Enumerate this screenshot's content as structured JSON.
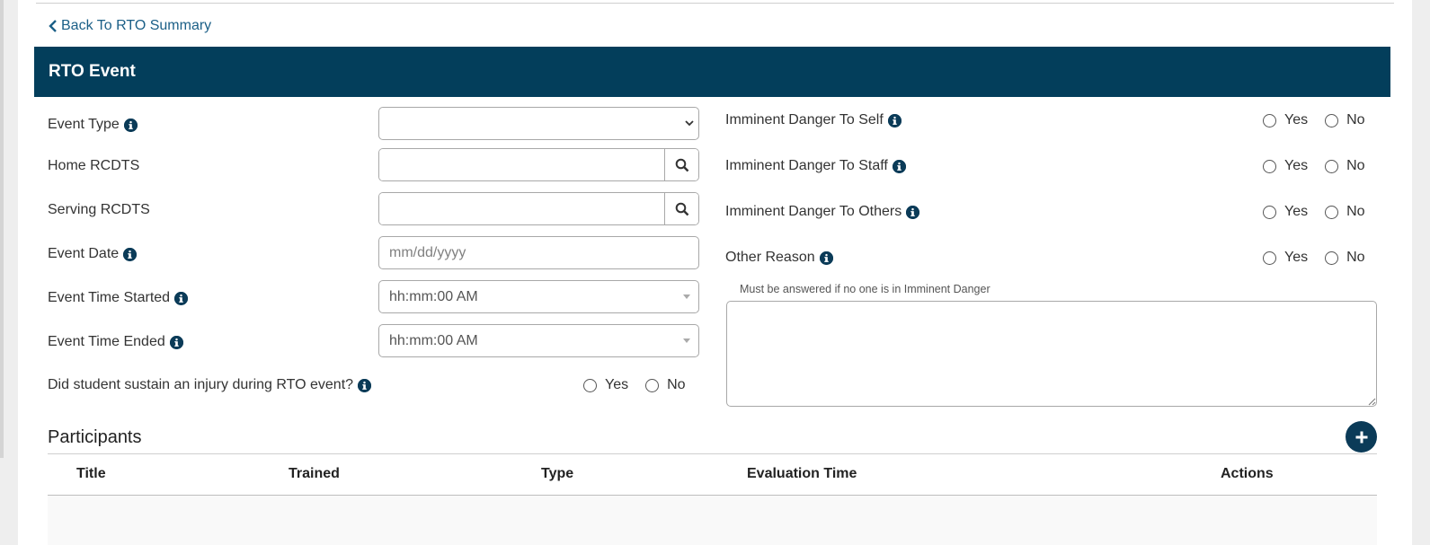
{
  "back_link": {
    "label": "Back To RTO Summary"
  },
  "header": {
    "title": "RTO Event"
  },
  "form": {
    "event_type": {
      "label": "Event Type",
      "value": ""
    },
    "home_rcdts": {
      "label": "Home RCDTS",
      "value": ""
    },
    "serving_rcdts": {
      "label": "Serving RCDTS",
      "value": ""
    },
    "event_date": {
      "label": "Event Date",
      "placeholder": "mm/dd/yyyy"
    },
    "time_started": {
      "label": "Event Time Started",
      "value": "hh:mm:00 AM"
    },
    "time_ended": {
      "label": "Event Time Ended",
      "value": "hh:mm:00 AM"
    },
    "injury": {
      "label": "Did student sustain an injury during RTO event?",
      "yes": "Yes",
      "no": "No"
    }
  },
  "danger": {
    "self": {
      "label": "Imminent Danger To Self",
      "yes": "Yes",
      "no": "No"
    },
    "staff": {
      "label": "Imminent Danger To Staff",
      "yes": "Yes",
      "no": "No"
    },
    "others": {
      "label": "Imminent Danger To Others",
      "yes": "Yes",
      "no": "No"
    },
    "other_reason": {
      "label": "Other Reason",
      "yes": "Yes",
      "no": "No"
    },
    "hint": "Must be answered if no one is in Imminent Danger"
  },
  "participants": {
    "title": "Participants",
    "columns": [
      "Title",
      "Trained",
      "Type",
      "Evaluation Time",
      "Actions"
    ]
  },
  "colors": {
    "header_bg": "#033e5b",
    "link": "#1b5f87",
    "icon": "#0b3b58"
  }
}
